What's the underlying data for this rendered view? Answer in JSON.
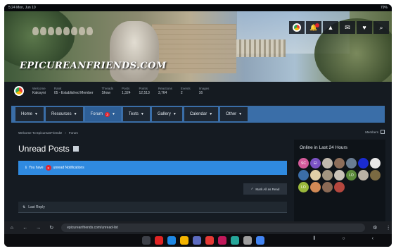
{
  "status_bar": {
    "time": "5:24",
    "date": "Mon, Jun 10",
    "battery": "79%"
  },
  "site": {
    "logo": "EPICUREANFRIENDS.COM"
  },
  "header_icons": [
    "chrome-avatar-icon",
    "bell-icon",
    "warning-icon",
    "chat-icon",
    "heart-icon",
    "search-icon"
  ],
  "member": {
    "stats": [
      {
        "label": "Welcome",
        "value": "Kalosyni"
      },
      {
        "label": "Rank",
        "value": "05 - Established Member"
      },
      {
        "label": "Threads",
        "value": "Show"
      },
      {
        "label": "Posts",
        "value": "1,324"
      },
      {
        "label": "Points",
        "value": "12,513"
      },
      {
        "label": "Reactions",
        "value": "3,764"
      },
      {
        "label": "Events",
        "value": "2"
      },
      {
        "label": "Images",
        "value": "16"
      }
    ]
  },
  "nav": {
    "items": [
      {
        "label": "Home",
        "active": false
      },
      {
        "label": "Resources",
        "active": false
      },
      {
        "label": "Forum",
        "active": true,
        "count": "3"
      },
      {
        "label": "Texts",
        "active": false
      },
      {
        "label": "Gallery",
        "active": false
      },
      {
        "label": "Calendar",
        "active": false
      },
      {
        "label": "Other",
        "active": false
      }
    ]
  },
  "breadcrumb": [
    "Welcome To EpicureanFriends!",
    "Forum"
  ],
  "quicklinks": "Members",
  "page": {
    "title": "Unread Posts",
    "notice_prefix": "You have",
    "notice_count": "3",
    "notice_suffix": "unread Notifications",
    "mark_read": "Mark All as Read",
    "filter_label": "Last Reply"
  },
  "sidebar": {
    "title": "Online in Last 24 Hours",
    "avatars": [
      {
        "initials": "SC",
        "color": "#d45a9a"
      },
      {
        "initials": "EI",
        "color": "#7b52c4"
      },
      {
        "initials": "",
        "color": "#c0b8ad"
      },
      {
        "initials": "",
        "color": "#8d6e5a"
      },
      {
        "initials": "",
        "color": "#6a7d92"
      },
      {
        "initials": "",
        "color": "#1a2bd1"
      },
      {
        "initials": "",
        "color": "#e8e8e8"
      },
      {
        "initials": "",
        "color": "#3b6da8"
      },
      {
        "initials": "",
        "color": "#e0cfa7"
      },
      {
        "initials": "",
        "color": "#a29581"
      },
      {
        "initials": "",
        "color": "#c9c3b8"
      },
      {
        "initials": "LO",
        "color": "#5b8a3a"
      },
      {
        "initials": "",
        "color": "#b9b2a5"
      },
      {
        "initials": "",
        "color": "#7a6a42"
      },
      {
        "initials": "LO",
        "color": "#9ab83b"
      },
      {
        "initials": "",
        "color": "#d28a55"
      },
      {
        "initials": "",
        "color": "#8b6a55"
      },
      {
        "initials": "",
        "color": "#b5473e"
      }
    ]
  },
  "browser": {
    "url": "epicureanfriends.com/unread-list",
    "icons": [
      "home-icon",
      "back-icon",
      "forward-icon",
      "reload-icon",
      "tune-icon"
    ]
  },
  "dock": {
    "apps": [
      {
        "name": "app-grid-icon",
        "color": "#3d4048"
      },
      {
        "name": "flipboard-icon",
        "color": "#e02424"
      },
      {
        "name": "translate-icon",
        "color": "#1e88e5"
      },
      {
        "name": "notes-icon",
        "color": "#f4b400"
      },
      {
        "name": "browser-icon",
        "color": "#5c6bc0"
      },
      {
        "name": "gallery-icon",
        "color": "#e53935"
      },
      {
        "name": "camera-icon",
        "color": "#c2185b"
      },
      {
        "name": "maps-icon",
        "color": "#26a69a"
      },
      {
        "name": "apps-icon",
        "color": "#9e9e9e"
      },
      {
        "name": "chrome-icon",
        "color": "#4285f4"
      }
    ],
    "nav": [
      "recents-icon",
      "home-nav-icon",
      "back-nav-icon"
    ]
  }
}
